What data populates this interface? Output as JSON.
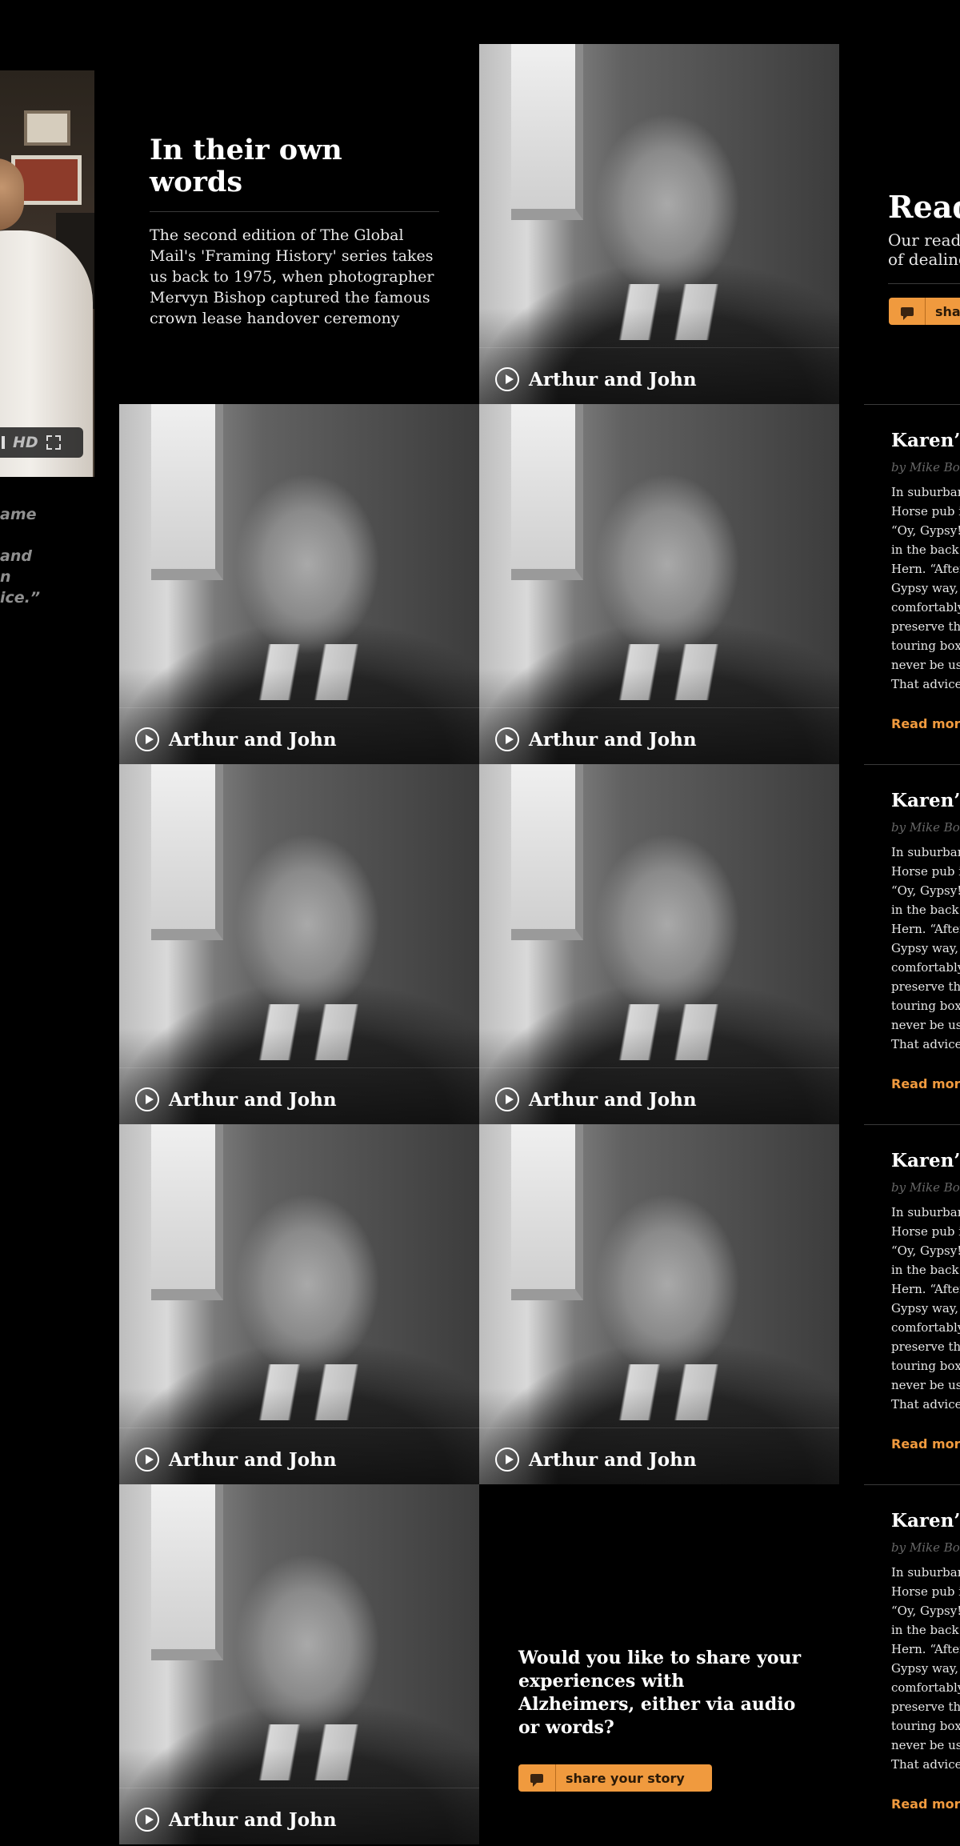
{
  "video_player": {
    "hd_label": "HD",
    "quote_lines": [
      "ame",
      "and",
      "n",
      "ice.”"
    ]
  },
  "intro": {
    "title": "In their own words",
    "description": "The second edition of The Global Mail's 'Framing History' series takes us back to 1975, when photographer Mervyn Bishop captured the famous crown lease handover ceremony"
  },
  "tiles": [
    {
      "caption": "Arthur and John",
      "icon": "play-icon"
    },
    {
      "caption": "Arthur and John",
      "icon": "play-icon"
    },
    {
      "caption": "Arthur and John",
      "icon": "play-icon"
    },
    {
      "caption": "Arthur and John",
      "icon": "play-icon"
    },
    {
      "caption": "Arthur and John",
      "icon": "play-icon"
    },
    {
      "caption": "Arthur and John",
      "icon": "play-icon"
    },
    {
      "caption": "Arthur and John",
      "icon": "play-icon"
    },
    {
      "caption": "Arthur and John",
      "icon": "play-icon"
    }
  ],
  "share_prompt": {
    "question": "Would you like to share your experiences with Alzheimers, either via audio or words?",
    "button_label": "share your story",
    "button_icon": "speech-bubble-icon"
  },
  "readers": {
    "title": "Read",
    "subtitle_lines": [
      "Our reade",
      "of dealing"
    ],
    "button_label": "sha",
    "button_icon": "speech-bubble-icon"
  },
  "stories": [
    {
      "title": "Karen’s",
      "byline": "by Mike Bou",
      "body_lines": [
        "In suburban",
        "Horse pub i",
        "“Oy, Gypsy!”",
        "in the back o",
        "Hern. “After",
        "Gypsy way, l",
        "comfortably",
        "preserve the",
        "touring boxe",
        "never be use",
        "That advice"
      ],
      "read_more": "Read more"
    },
    {
      "title": "Karen’s",
      "byline": "by Mike Bou",
      "body_lines": [
        "In suburban",
        "Horse pub i",
        "“Oy, Gypsy!”",
        "in the back o",
        "Hern. “After",
        "Gypsy way, l",
        "comfortably",
        "preserve the",
        "touring boxe",
        "never be use",
        "That advice"
      ],
      "read_more": "Read more"
    },
    {
      "title": "Karen’s",
      "byline": "by Mike Bou",
      "body_lines": [
        "In suburban",
        "Horse pub i",
        "“Oy, Gypsy!”",
        "in the back o",
        "Hern. “After",
        "Gypsy way, l",
        "comfortably",
        "preserve the",
        "touring boxe",
        "never be use",
        "That advice"
      ],
      "read_more": "Read more"
    },
    {
      "title": "Karen’s",
      "byline": "by Mike Bou",
      "body_lines": [
        "In suburban",
        "Horse pub i",
        "“Oy, Gypsy!”",
        "in the back o",
        "Hern. “After",
        "Gypsy way, l",
        "comfortably",
        "preserve the",
        "touring boxe",
        "never be use",
        "That advice"
      ],
      "read_more": "Read more"
    }
  ],
  "colors": {
    "background": "#000000",
    "accent_orange": "#f09a3e",
    "muted_text": "#8f8f8f"
  }
}
